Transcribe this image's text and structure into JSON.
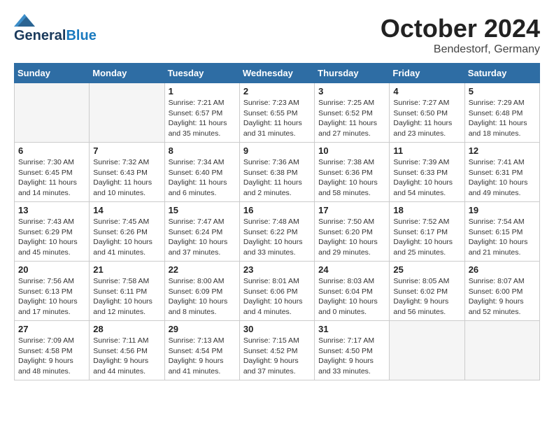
{
  "header": {
    "logo_line1": "General",
    "logo_line2": "Blue",
    "month": "October 2024",
    "location": "Bendestorf, Germany"
  },
  "weekdays": [
    "Sunday",
    "Monday",
    "Tuesday",
    "Wednesday",
    "Thursday",
    "Friday",
    "Saturday"
  ],
  "weeks": [
    [
      {
        "day": "",
        "info": ""
      },
      {
        "day": "",
        "info": ""
      },
      {
        "day": "1",
        "info": "Sunrise: 7:21 AM\nSunset: 6:57 PM\nDaylight: 11 hours\nand 35 minutes."
      },
      {
        "day": "2",
        "info": "Sunrise: 7:23 AM\nSunset: 6:55 PM\nDaylight: 11 hours\nand 31 minutes."
      },
      {
        "day": "3",
        "info": "Sunrise: 7:25 AM\nSunset: 6:52 PM\nDaylight: 11 hours\nand 27 minutes."
      },
      {
        "day": "4",
        "info": "Sunrise: 7:27 AM\nSunset: 6:50 PM\nDaylight: 11 hours\nand 23 minutes."
      },
      {
        "day": "5",
        "info": "Sunrise: 7:29 AM\nSunset: 6:48 PM\nDaylight: 11 hours\nand 18 minutes."
      }
    ],
    [
      {
        "day": "6",
        "info": "Sunrise: 7:30 AM\nSunset: 6:45 PM\nDaylight: 11 hours\nand 14 minutes."
      },
      {
        "day": "7",
        "info": "Sunrise: 7:32 AM\nSunset: 6:43 PM\nDaylight: 11 hours\nand 10 minutes."
      },
      {
        "day": "8",
        "info": "Sunrise: 7:34 AM\nSunset: 6:40 PM\nDaylight: 11 hours\nand 6 minutes."
      },
      {
        "day": "9",
        "info": "Sunrise: 7:36 AM\nSunset: 6:38 PM\nDaylight: 11 hours\nand 2 minutes."
      },
      {
        "day": "10",
        "info": "Sunrise: 7:38 AM\nSunset: 6:36 PM\nDaylight: 10 hours\nand 58 minutes."
      },
      {
        "day": "11",
        "info": "Sunrise: 7:39 AM\nSunset: 6:33 PM\nDaylight: 10 hours\nand 54 minutes."
      },
      {
        "day": "12",
        "info": "Sunrise: 7:41 AM\nSunset: 6:31 PM\nDaylight: 10 hours\nand 49 minutes."
      }
    ],
    [
      {
        "day": "13",
        "info": "Sunrise: 7:43 AM\nSunset: 6:29 PM\nDaylight: 10 hours\nand 45 minutes."
      },
      {
        "day": "14",
        "info": "Sunrise: 7:45 AM\nSunset: 6:26 PM\nDaylight: 10 hours\nand 41 minutes."
      },
      {
        "day": "15",
        "info": "Sunrise: 7:47 AM\nSunset: 6:24 PM\nDaylight: 10 hours\nand 37 minutes."
      },
      {
        "day": "16",
        "info": "Sunrise: 7:48 AM\nSunset: 6:22 PM\nDaylight: 10 hours\nand 33 minutes."
      },
      {
        "day": "17",
        "info": "Sunrise: 7:50 AM\nSunset: 6:20 PM\nDaylight: 10 hours\nand 29 minutes."
      },
      {
        "day": "18",
        "info": "Sunrise: 7:52 AM\nSunset: 6:17 PM\nDaylight: 10 hours\nand 25 minutes."
      },
      {
        "day": "19",
        "info": "Sunrise: 7:54 AM\nSunset: 6:15 PM\nDaylight: 10 hours\nand 21 minutes."
      }
    ],
    [
      {
        "day": "20",
        "info": "Sunrise: 7:56 AM\nSunset: 6:13 PM\nDaylight: 10 hours\nand 17 minutes."
      },
      {
        "day": "21",
        "info": "Sunrise: 7:58 AM\nSunset: 6:11 PM\nDaylight: 10 hours\nand 12 minutes."
      },
      {
        "day": "22",
        "info": "Sunrise: 8:00 AM\nSunset: 6:09 PM\nDaylight: 10 hours\nand 8 minutes."
      },
      {
        "day": "23",
        "info": "Sunrise: 8:01 AM\nSunset: 6:06 PM\nDaylight: 10 hours\nand 4 minutes."
      },
      {
        "day": "24",
        "info": "Sunrise: 8:03 AM\nSunset: 6:04 PM\nDaylight: 10 hours\nand 0 minutes."
      },
      {
        "day": "25",
        "info": "Sunrise: 8:05 AM\nSunset: 6:02 PM\nDaylight: 9 hours\nand 56 minutes."
      },
      {
        "day": "26",
        "info": "Sunrise: 8:07 AM\nSunset: 6:00 PM\nDaylight: 9 hours\nand 52 minutes."
      }
    ],
    [
      {
        "day": "27",
        "info": "Sunrise: 7:09 AM\nSunset: 4:58 PM\nDaylight: 9 hours\nand 48 minutes."
      },
      {
        "day": "28",
        "info": "Sunrise: 7:11 AM\nSunset: 4:56 PM\nDaylight: 9 hours\nand 44 minutes."
      },
      {
        "day": "29",
        "info": "Sunrise: 7:13 AM\nSunset: 4:54 PM\nDaylight: 9 hours\nand 41 minutes."
      },
      {
        "day": "30",
        "info": "Sunrise: 7:15 AM\nSunset: 4:52 PM\nDaylight: 9 hours\nand 37 minutes."
      },
      {
        "day": "31",
        "info": "Sunrise: 7:17 AM\nSunset: 4:50 PM\nDaylight: 9 hours\nand 33 minutes."
      },
      {
        "day": "",
        "info": ""
      },
      {
        "day": "",
        "info": ""
      }
    ]
  ]
}
